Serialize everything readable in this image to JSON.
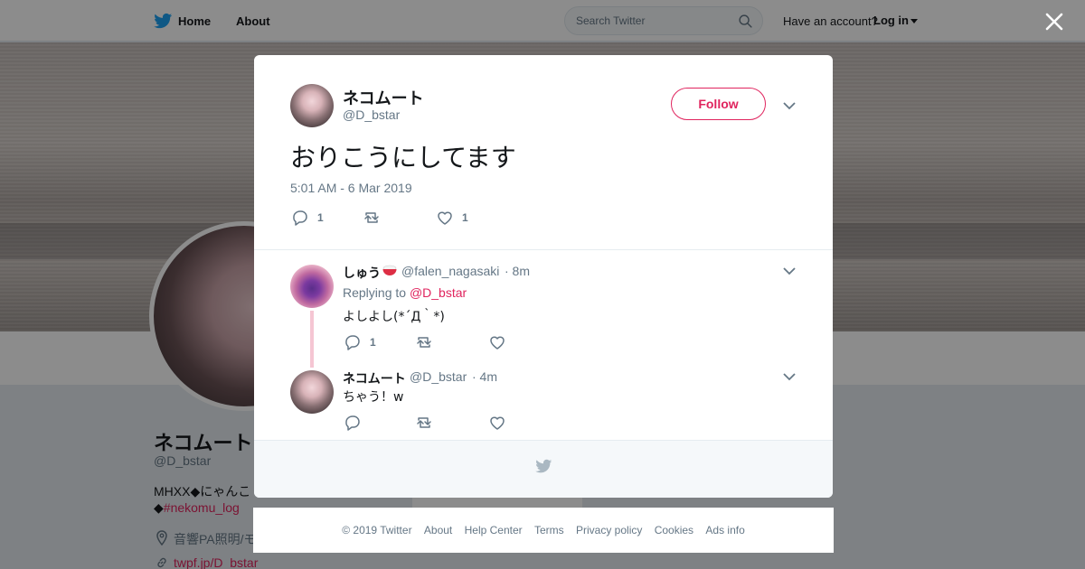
{
  "nav": {
    "home": "Home",
    "about": "About",
    "search_placeholder": "Search Twitter",
    "have_account": "Have an account?",
    "login": "Log in"
  },
  "profile": {
    "name": "ネコムート",
    "handle": "@D_bstar",
    "bio_line1": "MHXX◆にゃんこ",
    "bio_line2_prefix": "◆",
    "bio_hashtag": "#nekomu_log",
    "location": "音響PA照明/モ",
    "url": "twpf.jp/D_bstar"
  },
  "tweet": {
    "author_name": "ネコムート",
    "author_handle": "@D_bstar",
    "follow_label": "Follow",
    "text": "おりこうにしてます",
    "timestamp": "5:01 AM - 6 Mar 2019",
    "reply_count": "1",
    "like_count": "1"
  },
  "replies": [
    {
      "name": "しゅう",
      "handle": "@falen_nagasaki",
      "time": "· 8m",
      "replying_prefix": "Replying to",
      "replying_to": "@D_bstar",
      "text": "よしよし(*´Д｀*)",
      "reply_count": "1"
    },
    {
      "name": "ネコムート",
      "handle": "@D_bstar",
      "time": "· 4m",
      "text": "ちゃう！w"
    }
  ],
  "footer": {
    "copyright": "© 2019 Twitter",
    "about": "About",
    "help": "Help Center",
    "terms": "Terms",
    "privacy": "Privacy policy",
    "cookies": "Cookies",
    "ads": "Ads info"
  },
  "colors": {
    "accent": "#e0245e",
    "secondary_text": "#657786",
    "twitter_blue": "#1da1f2"
  }
}
